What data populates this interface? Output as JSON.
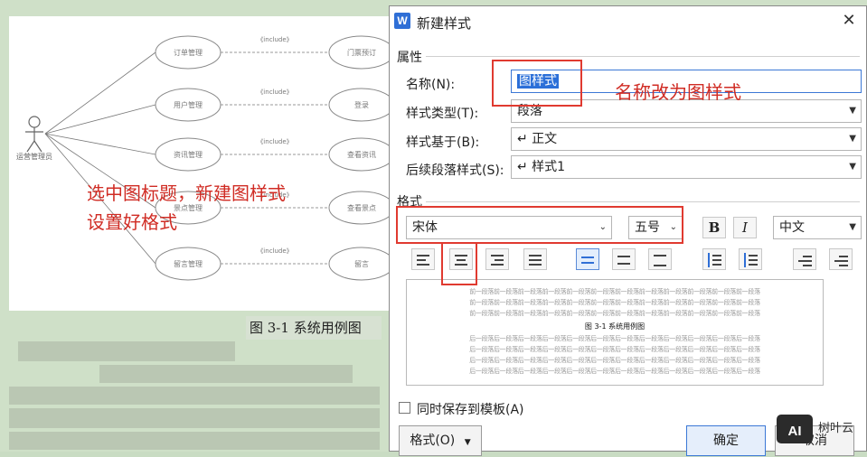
{
  "background": {
    "doc_caption": "图 3-1 系统用例图",
    "annotation_left": [
      "选中图标题，新建图样式",
      "设置好格式"
    ],
    "diagram": {
      "actor": "运营管理员",
      "left_cases": [
        "订单管理",
        "用户管理",
        "资讯管理",
        "景点管理",
        "留言管理"
      ],
      "right_cases": [
        "门票预订",
        "登录",
        "查看资讯",
        "查看景点",
        "留言"
      ],
      "relation": "《include》"
    }
  },
  "dialog": {
    "title": "新建样式",
    "app_icon": "W",
    "close": "✕",
    "sections": {
      "properties": "属性",
      "format": "格式"
    },
    "fields": {
      "name_label": "名称(N):",
      "name_value": "图样式",
      "style_type_label": "样式类型(T):",
      "style_type_value": "段落",
      "based_on_label": "样式基于(B):",
      "based_on_value": "↵ 正文",
      "next_style_label": "后续段落样式(S):",
      "next_style_value": "↵ 样式1"
    },
    "format": {
      "font": "宋体",
      "size": "五号",
      "bold": "B",
      "italic": "I",
      "script": "中文"
    },
    "preview": {
      "filler": "前一段落前一段落前一段落前一段落前一段落前一段落前一段落前一段落前一段落前一段落前一段落前一段落",
      "sample": "图 3-1 系统用例图",
      "after": "后一段落后一段落后一段落后一段落后一段落后一段落后一段落后一段落后一段落后一段落后一段落后一段落"
    },
    "save_to_template": "同时保存到模板(A)",
    "format_button": "格式(O)",
    "ok_button": "确定",
    "cancel_button": "取消"
  },
  "annotation_right": "名称改为图样式",
  "watermark": "树叶云",
  "colors": {
    "annotation_red": "#d02c24",
    "selection_blue": "#2b6fd8"
  }
}
